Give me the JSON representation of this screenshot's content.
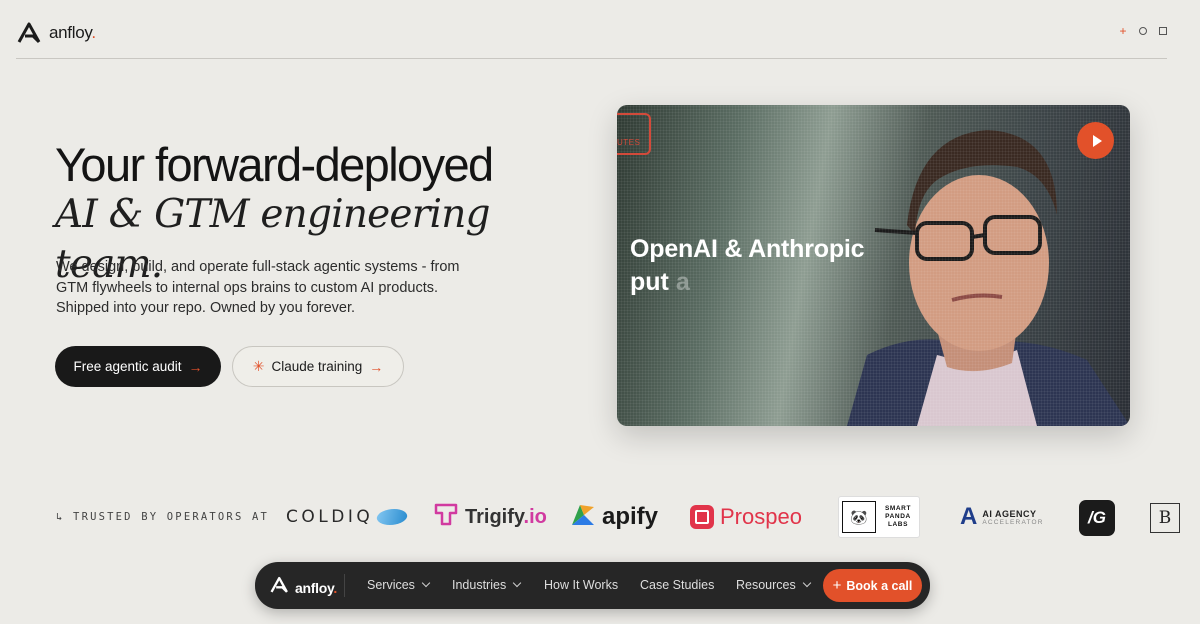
{
  "brand": {
    "name": "anfloy",
    "dot": "."
  },
  "window_controls": [
    "plus-icon",
    "circle-icon",
    "square-icon"
  ],
  "hero": {
    "title_line1": "Your forward-deployed",
    "title_line2": "AI & GTM engineering team.",
    "description": [
      "We design, build, and operate full-stack agentic systems - from",
      "GTM flywheels to internal ops brains to custom AI products.",
      "Shipped into your repo. Owned by you forever."
    ],
    "primary_cta": "Free agentic audit",
    "secondary_cta": "Claude training"
  },
  "video": {
    "caption_line1": "OpenAI & Anthropic",
    "caption_line2": "put",
    "caption_line2_fade": "a",
    "corner_badge": "UTES",
    "play_icon": "play-icon"
  },
  "trusted": {
    "label": "TRUSTED BY OPERATORS AT",
    "logos": {
      "coldiq": "COLDIQ",
      "trigify": "Trigify",
      "trigify_suffix": ".io",
      "apify": "apify",
      "prospeo": "Prospeo",
      "panda_line1": "SMART",
      "panda_line2": "PANDA",
      "panda_line3": "LABS",
      "aiagency_mark": "A",
      "aiagency_line1": "AI AGENCY",
      "aiagency_line2": "ACCELERATOR",
      "ig": "/G",
      "b": "B"
    }
  },
  "navbar": {
    "brand": "anfloy",
    "brand_dot": ".",
    "items": [
      {
        "label": "Services",
        "dropdown": true
      },
      {
        "label": "Industries",
        "dropdown": true
      },
      {
        "label": "How It Works",
        "dropdown": false
      },
      {
        "label": "Case Studies",
        "dropdown": false
      },
      {
        "label": "Resources",
        "dropdown": true
      }
    ],
    "cta": "Book a call",
    "cta_icon": "+"
  },
  "colors": {
    "background": "#ecebe7",
    "accent": "#e2512a",
    "dark": "#191919",
    "navbar": "#262626"
  }
}
